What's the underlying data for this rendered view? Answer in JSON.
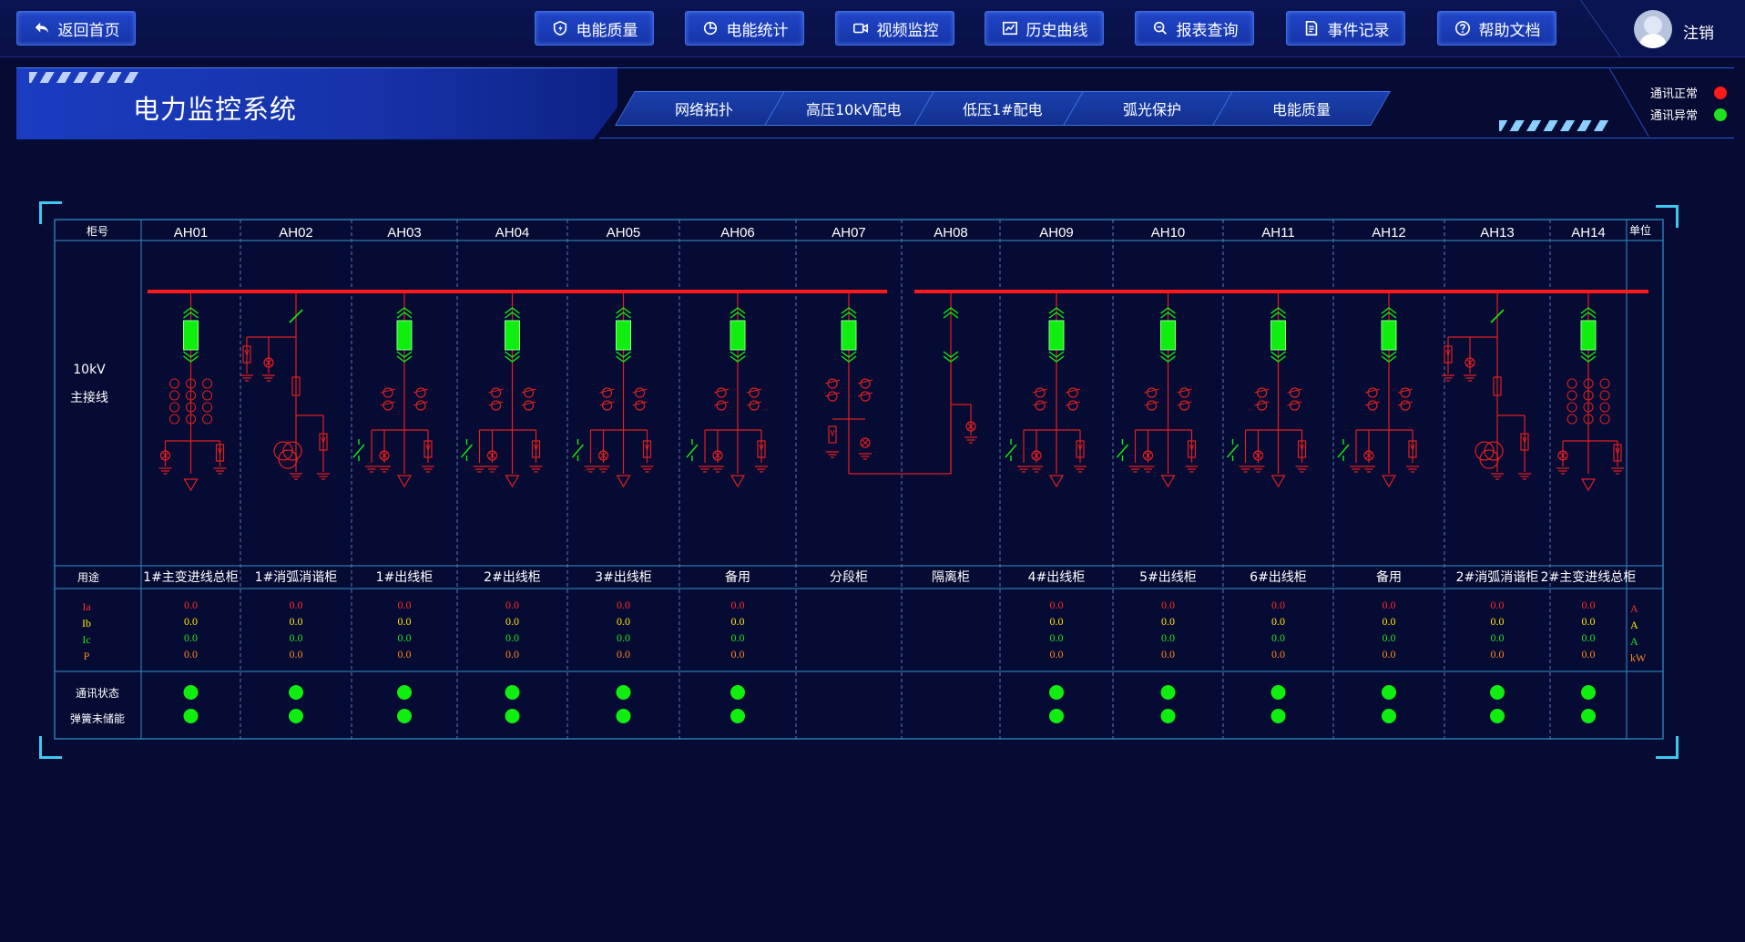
{
  "nav": {
    "home": "返回首页",
    "items": [
      "电能质量",
      "电能统计",
      "视频监控",
      "历史曲线",
      "报表查询",
      "事件记录",
      "帮助文档"
    ],
    "logout": "注销"
  },
  "title": "电力监控系统",
  "sub_tabs": [
    "网络拓扑",
    "高压10kV配电",
    "低压1#配电",
    "弧光保护",
    "电能质量"
  ],
  "legend": [
    {
      "label": "通讯正常",
      "color": "#ff1a1a"
    },
    {
      "label": "通讯异常",
      "color": "#22e022"
    }
  ],
  "table": {
    "col_header_label": "柜号",
    "unit_label": "单位",
    "main_line_label": [
      "10kV",
      "主接线"
    ],
    "purpose_label": "用途",
    "comm_label": "通讯状态",
    "spring_label": "弹簧未储能",
    "cabinets": [
      "AH01",
      "AH02",
      "AH03",
      "AH04",
      "AH05",
      "AH06",
      "AH07",
      "AH08",
      "AH09",
      "AH10",
      "AH11",
      "AH12",
      "AH13",
      "AH14"
    ],
    "purposes": [
      "1#主变进线总柜",
      "1#消弧消谐柜",
      "1#出线柜",
      "2#出线柜",
      "3#出线柜",
      "备用",
      "分段柜",
      "隔离柜",
      "4#出线柜",
      "5#出线柜",
      "6#出线柜",
      "备用",
      "2#消弧消谐柜",
      "2#主变进线总柜"
    ],
    "measure_labels": [
      "Ia",
      "Ib",
      "Ic",
      "P"
    ],
    "units": [
      "A",
      "A",
      "A",
      "kW"
    ],
    "measure_colors": [
      "#ff2a2a",
      "#ffe600",
      "#22e022",
      "#ff8a1a"
    ],
    "values": [
      [
        "0.0",
        "0.0",
        "0.0",
        "0.0"
      ],
      [
        "0.0",
        "0.0",
        "0.0",
        "0.0"
      ],
      [
        "0.0",
        "0.0",
        "0.0",
        "0.0"
      ],
      [
        "0.0",
        "0.0",
        "0.0",
        "0.0"
      ],
      [
        "0.0",
        "0.0",
        "0.0",
        "0.0"
      ],
      [
        "0.0",
        "0.0",
        "0.0",
        "0.0"
      ],
      null,
      null,
      [
        "0.0",
        "0.0",
        "0.0",
        "0.0"
      ],
      [
        "0.0",
        "0.0",
        "0.0",
        "0.0"
      ],
      [
        "0.0",
        "0.0",
        "0.0",
        "0.0"
      ],
      [
        "0.0",
        "0.0",
        "0.0",
        "0.0"
      ],
      [
        "0.0",
        "0.0",
        "0.0",
        "0.0"
      ],
      [
        "0.0",
        "0.0",
        "0.0",
        "0.0"
      ]
    ],
    "status": [
      true,
      true,
      true,
      true,
      true,
      true,
      false,
      false,
      true,
      true,
      true,
      true,
      true,
      true
    ],
    "cabinet_types": [
      "incoming",
      "arc",
      "feeder",
      "feeder",
      "feeder",
      "feeder",
      "bus-tie",
      "isolation",
      "feeder",
      "feeder",
      "feeder",
      "feeder",
      "arc",
      "incoming"
    ]
  },
  "colors": {
    "busbar": "#ff1a1a",
    "breaker": "#10ee10",
    "status_dot": "#10ee10",
    "grid": "#2a7ab0"
  }
}
